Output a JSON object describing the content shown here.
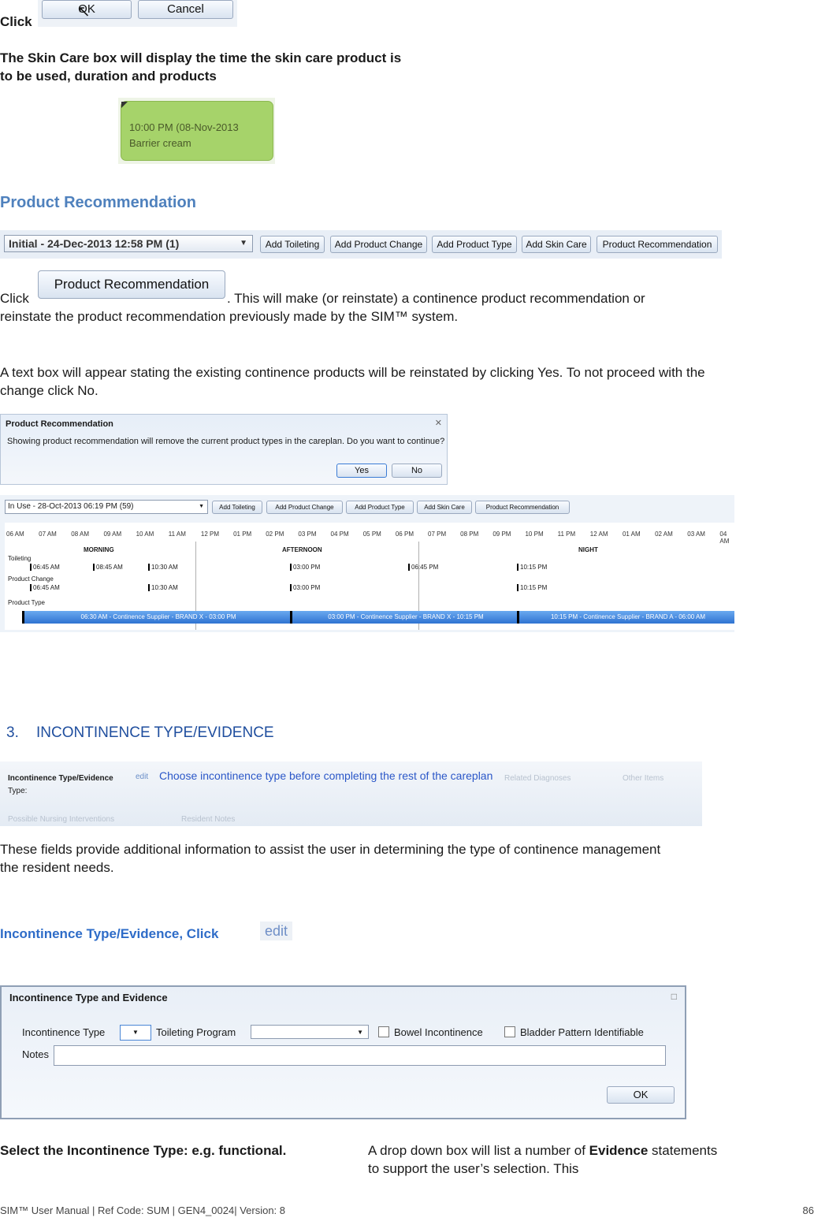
{
  "intro": {
    "click": "Click",
    "ok": "OK",
    "cancel": "Cancel"
  },
  "skin_care_text": "The Skin Care box will display the time the skin care product is to be used, duration and products",
  "skin_box": {
    "line1": "10:00 PM (08-Nov-2013",
    "line2": "Barrier cream",
    "color": "#a6d36a"
  },
  "product_rec": {
    "heading": "Product Recommendation",
    "toolbar": {
      "dropdown": "Initial - 24-Dec-2013 12:58 PM (1)",
      "buttons": [
        "Add Toileting",
        "Add Product Change",
        "Add Product Type",
        "Add Skin Care",
        "Product Recommendation"
      ]
    },
    "click": "Click",
    "button": "Product Recommendation",
    "para1": ".  This will make (or reinstate) a continence product recommendation or reinstate the product recommendation previously made by the SIM™ system.",
    "para2": "A text box will appear stating the existing continence products will be reinstated by clicking Yes. To not proceed with the change click No.",
    "dialog": {
      "title": "Product Recommendation",
      "message": "Showing product recommendation will remove the current product types in the careplan. Do you want to continue?",
      "yes": "Yes",
      "no": "No"
    }
  },
  "timeline": {
    "dropdown": "In Use - 28-Oct-2013 06:19 PM (59)",
    "buttons": [
      "Add Toileting",
      "Add Product Change",
      "Add Product Type",
      "Add Skin Care",
      "Product Recommendation"
    ],
    "hours": [
      "06 AM",
      "07 AM",
      "08 AM",
      "09 AM",
      "10 AM",
      "11 AM",
      "12 PM",
      "01 PM",
      "02 PM",
      "03 PM",
      "04 PM",
      "05 PM",
      "06 PM",
      "07 PM",
      "08 PM",
      "09 PM",
      "10 PM",
      "11 PM",
      "12 AM",
      "01 AM",
      "02 AM",
      "03 AM",
      "04 AM"
    ],
    "periods": [
      "MORNING",
      "AFTERNOON",
      "NIGHT"
    ],
    "rows": {
      "toileting": {
        "label": "Toileting",
        "times": [
          "06:45 AM",
          "08:45 AM",
          "10:30 AM",
          "03:00 PM",
          "06:45 PM",
          "10:15 PM"
        ]
      },
      "product_change": {
        "label": "Product Change",
        "times": [
          "06:45 AM",
          "10:30 AM",
          "03:00 PM",
          "10:15 PM"
        ]
      },
      "product_type": {
        "label": "Product Type",
        "bars": [
          "06:30 AM - Continence Supplier - BRAND X - 03:00 PM",
          "03:00 PM - Continence Supplier - BRAND X - 10:15 PM",
          "10:15 PM - Continence Supplier - BRAND A - 06:00 AM"
        ]
      }
    }
  },
  "section3": {
    "number": "3.",
    "title": "INCONTINENCE TYPE/EVIDENCE",
    "panel": {
      "label1": "Incontinence Type/Evidence",
      "edit": "edit",
      "label2": "Type:",
      "notice": "Choose incontinence type before completing the rest of the careplan",
      "related": "Related Diagnoses",
      "other": "Other Items",
      "interventions": "Possible Nursing Interventions",
      "notes": "Resident Notes"
    },
    "para": "These fields provide additional information to assist the user in determining the type of continence management the resident needs."
  },
  "incontinence_click": {
    "text": "Incontinence Type/Evidence, Click",
    "edit": "edit"
  },
  "dialog2": {
    "title": "Incontinence Type and Evidence",
    "type_label": "Incontinence Type",
    "toileting_label": "Toileting Program",
    "bowel": "Bowel Incontinence",
    "bladder": "Bladder Pattern Identifiable",
    "notes": "Notes",
    "ok": "OK"
  },
  "bottom": {
    "left": "Select the Incontinence Type: e.g. functional.",
    "right_pre": "A drop down box will list a number of",
    "right_bold": "Evidence",
    "right_post": "statements to support the user’s selection. This"
  },
  "footer": {
    "left": "SIM™ User Manual | Ref Code: SUM | GEN4_0024| Version: 8",
    "page": "86"
  }
}
